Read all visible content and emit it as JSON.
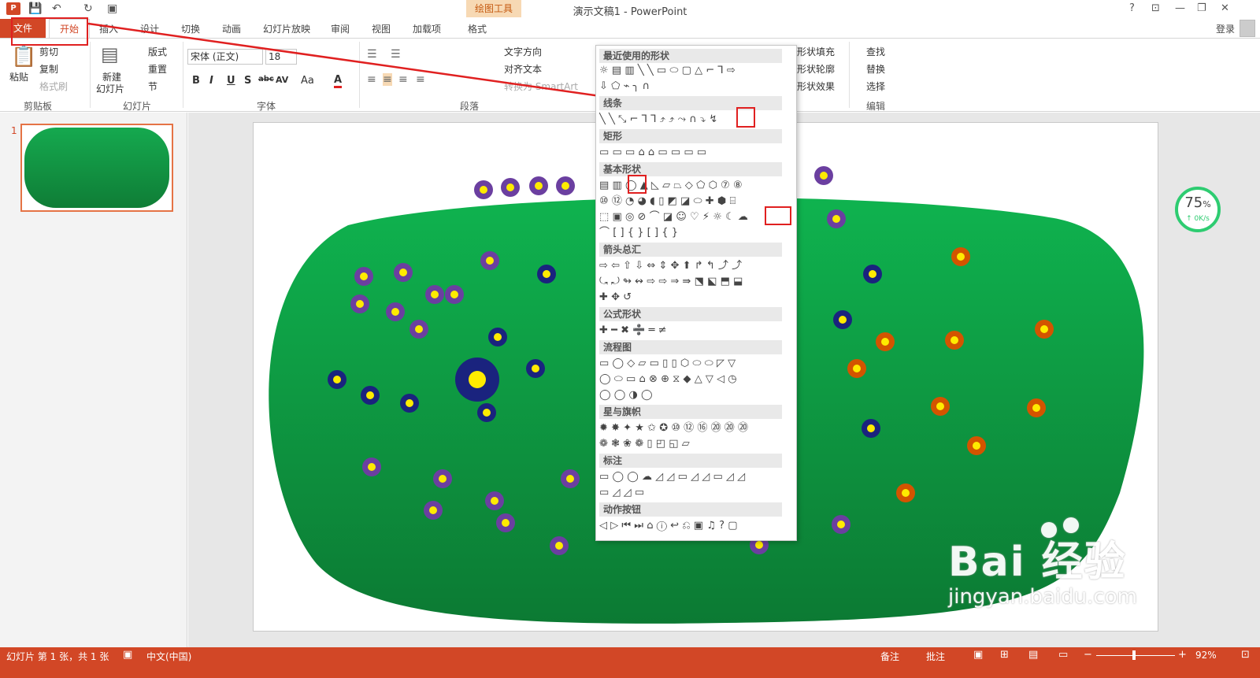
{
  "window": {
    "title": "演示文稿1 - PowerPoint",
    "context_tab_header": "绘图工具",
    "help": "?",
    "ribbon_display": "⊡",
    "minimize": "—",
    "restore": "❐",
    "close": "✕"
  },
  "qat": {
    "save_icon": "💾",
    "undo_icon": "↶",
    "redo_icon": "↻",
    "present_icon": "▣"
  },
  "tabs": {
    "file": "文件",
    "home": "开始",
    "insert": "插入",
    "design": "设计",
    "transitions": "切换",
    "animations": "动画",
    "slideshow": "幻灯片放映",
    "review": "审阅",
    "view": "视图",
    "addins": "加载项",
    "format": "格式"
  },
  "account": {
    "login": "登录"
  },
  "ribbon": {
    "clipboard": {
      "paste": "粘贴",
      "cut": "剪切",
      "copy": "复制",
      "format_painter": "格式刷",
      "group": "剪贴板"
    },
    "slides": {
      "new_slide_line1": "新建",
      "new_slide_line2": "幻灯片",
      "layout": "版式",
      "reset": "重置",
      "section": "节",
      "group": "幻灯片"
    },
    "font": {
      "family": "宋体 (正文)",
      "size": "18",
      "group": "字体",
      "bold": "B",
      "italic": "I",
      "underline": "U",
      "shadow": "S",
      "strike": "abc",
      "spacing": "AV",
      "case": "Aa",
      "color": "A"
    },
    "paragraph": {
      "text_direction": "文字方向",
      "align_text": "对齐文本",
      "smartart": "转换为 SmartArt",
      "group": "段落"
    },
    "drawing": {
      "fill": "形状填充",
      "outline": "形状轮廓",
      "effects": "形状效果"
    },
    "editing": {
      "find": "查找",
      "replace": "替换",
      "select": "选择",
      "group": "编辑"
    }
  },
  "slides_pane": {
    "slide_number": "1"
  },
  "shapes_gallery": {
    "sections": [
      "最近使用的形状",
      "线条",
      "矩形",
      "基本形状",
      "箭头总汇",
      "公式形状",
      "流程图",
      "星与旗帜",
      "标注",
      "动作按钮"
    ],
    "rows": {
      "recent1": "☼▤▥╲╲▭⬭▢△⌐⅂⇨",
      "recent2": "⇩⬠⌁╮∩",
      "lines": "╲╲⤡⌐⅂⅂⤴⤴⤳∩⤵↯",
      "rects": "▭▭▭⌂⌂▭▭▭▭",
      "basic1": "▤▥◯▲◺▱⏢◇⬠⬡⑦⑧",
      "basic2": "⑩⑫◔◕◖▯◩◪⬭✚⬢⌸",
      "basic3": "⬚▣◎⊘⌒◪☺♡⚡☼☾☁",
      "basic4": "⌒[]{}[]{}",
      "arrows1": "⇨⇦⇧⇩⇔⇕✥⬆↱↰⤴⤴",
      "arrows2": "⤿⤾↬↭⇨⇨⇒⇛⬔⬕⬒⬓",
      "arrows3": "✚✥↺",
      "equation": "✚━✖➗═≠",
      "flow1": "▭◯◇▱▭▯▯⬡⬭⬭◸▽",
      "flow2": "◯⬭▭⌂⊗⊕⧖◆△▽◁◷",
      "flow3": "◯◯◑◯",
      "stars1": "✹✸✦★✩✪⑩⑫⑯⑳⑳⑳",
      "stars2": "❁❃❀❁▯◰◱▱",
      "callouts1": "▭◯◯☁◿◿▭◿◿▭◿◿",
      "callouts2": "▭◿◿▭",
      "actions": "◁▷⏮⏭⌂ⓘ↩⎌▣♫?▢"
    }
  },
  "progress_widget": {
    "percent": "75",
    "percent_sign": "%",
    "speed": "↑ 0K/s",
    "level": 0.75
  },
  "watermark": {
    "brand": "Bai  经验",
    "url": "jingyan.baidu.com"
  },
  "status": {
    "slide_info": "幻灯片 第 1 张，共 1 张",
    "language": "中文(中国)",
    "notes": "备注",
    "comments": "批注",
    "zoom": "92%"
  },
  "colors": {
    "accent": "#d24726",
    "highlight": "#e02020",
    "grass_top": "#0fb34f",
    "grass_bottom": "#0c7a33"
  }
}
